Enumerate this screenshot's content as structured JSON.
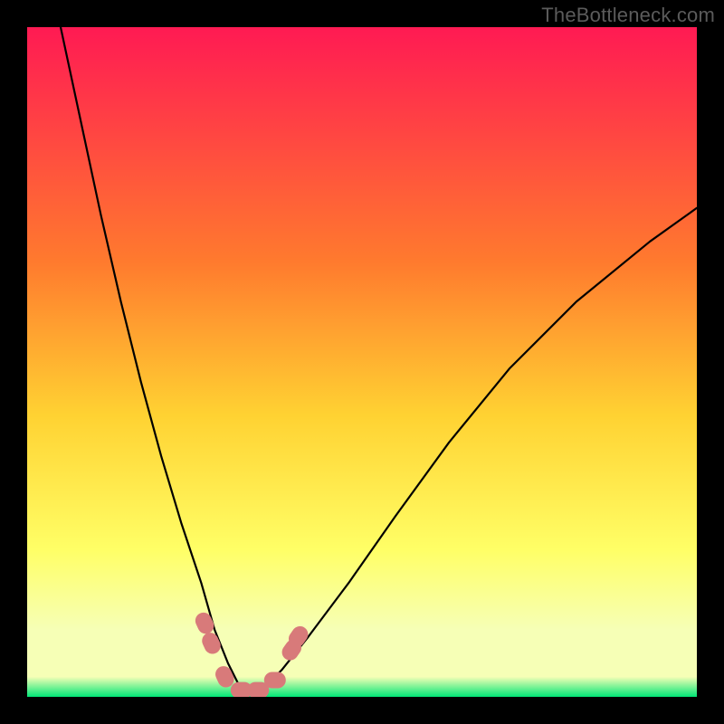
{
  "watermark": "TheBottleneck.com",
  "colors": {
    "frame": "#000000",
    "gradient_top": "#ff1a53",
    "gradient_mid1": "#ff7a2e",
    "gradient_mid2": "#ffd232",
    "gradient_mid3": "#ffff66",
    "gradient_mid4": "#f6ffb6",
    "gradient_bottom": "#00e676",
    "curve": "#000000",
    "marker": "#d87a7a"
  },
  "chart_data": {
    "type": "line",
    "title": "",
    "xlabel": "",
    "ylabel": "",
    "xlim": [
      0,
      100
    ],
    "ylim": [
      0,
      100
    ],
    "note": "V-shaped bottleneck curve on heat-gradient background; minimum near x≈32. Values are estimated from pixel positions (gridless chart).",
    "series": [
      {
        "name": "bottleneck-curve",
        "x": [
          5,
          8,
          11,
          14,
          17,
          20,
          23,
          26,
          28,
          30,
          32,
          34,
          36,
          38,
          42,
          48,
          55,
          63,
          72,
          82,
          93,
          100
        ],
        "y": [
          100,
          86,
          72,
          59,
          47,
          36,
          26,
          17,
          10,
          5,
          1,
          1,
          2,
          4,
          9,
          17,
          27,
          38,
          49,
          59,
          68,
          73
        ]
      }
    ],
    "markers": [
      {
        "x": 26.5,
        "y": 11
      },
      {
        "x": 27.5,
        "y": 8
      },
      {
        "x": 29.5,
        "y": 3
      },
      {
        "x": 32.0,
        "y": 1
      },
      {
        "x": 34.5,
        "y": 1
      },
      {
        "x": 37.0,
        "y": 2.5
      },
      {
        "x": 39.5,
        "y": 7
      },
      {
        "x": 40.5,
        "y": 9
      }
    ],
    "gradient_stops": [
      {
        "pct": 0,
        "value": 100
      },
      {
        "pct": 35,
        "value": 65
      },
      {
        "pct": 58,
        "value": 42
      },
      {
        "pct": 78,
        "value": 22
      },
      {
        "pct": 90,
        "value": 10
      },
      {
        "pct": 100,
        "value": 0
      }
    ]
  }
}
